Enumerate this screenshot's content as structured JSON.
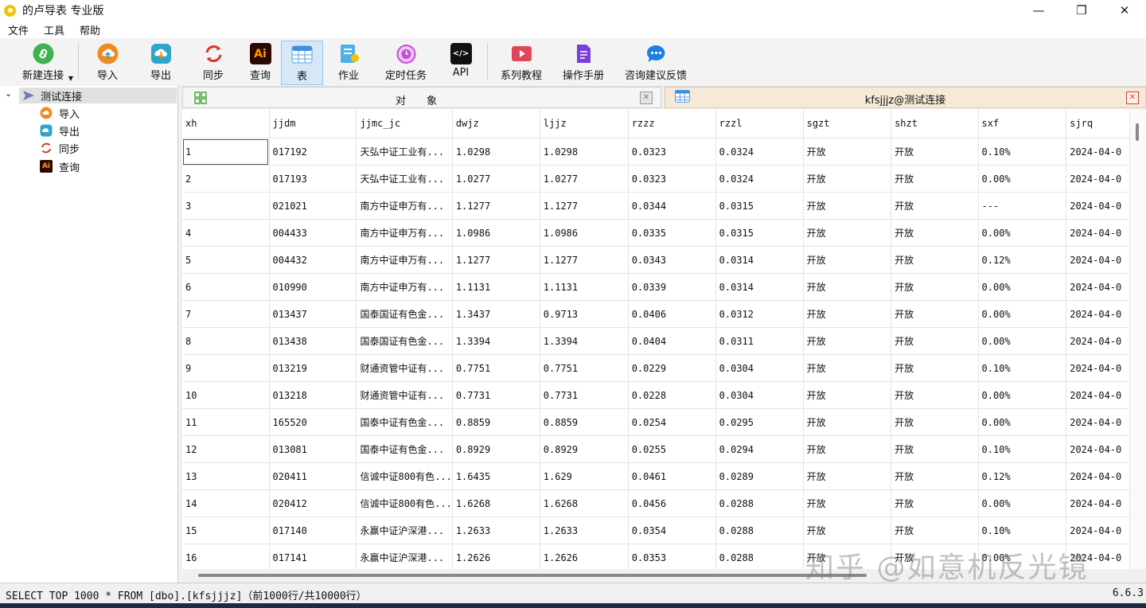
{
  "window": {
    "title": "的卢导表 专业版",
    "minimize": "—",
    "maximize": "❐",
    "close": "✕"
  },
  "menu": [
    "文件",
    "工具",
    "帮助"
  ],
  "toolbar": {
    "new_connection": "新建连接",
    "import": "导入",
    "export": "导出",
    "sync": "同步",
    "query": "查询",
    "table": "表",
    "job": "作业",
    "scheduled_task": "定时任务",
    "api": "API",
    "tutorials": "系列教程",
    "manual": "操作手册",
    "feedback": "咨询建议反馈",
    "query_icon_text": "Ai",
    "api_icon_text": "</>"
  },
  "tree": {
    "root": "测试连接",
    "items": [
      "导入",
      "导出",
      "同步",
      "查询"
    ],
    "query_icon_text": "Ai"
  },
  "tabs": {
    "objects_label": "对　　象",
    "objects_close": "✕",
    "table_tab_label": "kfsjjjz@测试连接",
    "table_tab_close": "✕"
  },
  "grid": {
    "columns": [
      "xh",
      "jjdm",
      "jjmc_jc",
      "dwjz",
      "ljjz",
      "rzzz",
      "rzzl",
      "sgzt",
      "shzt",
      "sxf",
      "sjrq"
    ],
    "rows": [
      [
        "1",
        "017192",
        "天弘中证工业有...",
        "1.0298",
        "1.0298",
        "0.0323",
        "0.0324",
        "开放",
        "开放",
        "0.10%",
        "2024-04-0"
      ],
      [
        "2",
        "017193",
        "天弘中证工业有...",
        "1.0277",
        "1.0277",
        "0.0323",
        "0.0324",
        "开放",
        "开放",
        "0.00%",
        "2024-04-0"
      ],
      [
        "3",
        "021021",
        "南方中证申万有...",
        "1.1277",
        "1.1277",
        "0.0344",
        "0.0315",
        "开放",
        "开放",
        "---",
        "2024-04-0"
      ],
      [
        "4",
        "004433",
        "南方中证申万有...",
        "1.0986",
        "1.0986",
        "0.0335",
        "0.0315",
        "开放",
        "开放",
        "0.00%",
        "2024-04-0"
      ],
      [
        "5",
        "004432",
        "南方中证申万有...",
        "1.1277",
        "1.1277",
        "0.0343",
        "0.0314",
        "开放",
        "开放",
        "0.12%",
        "2024-04-0"
      ],
      [
        "6",
        "010990",
        "南方中证申万有...",
        "1.1131",
        "1.1131",
        "0.0339",
        "0.0314",
        "开放",
        "开放",
        "0.00%",
        "2024-04-0"
      ],
      [
        "7",
        "013437",
        "国泰国证有色金...",
        "1.3437",
        "0.9713",
        "0.0406",
        "0.0312",
        "开放",
        "开放",
        "0.00%",
        "2024-04-0"
      ],
      [
        "8",
        "013438",
        "国泰国证有色金...",
        "1.3394",
        "1.3394",
        "0.0404",
        "0.0311",
        "开放",
        "开放",
        "0.00%",
        "2024-04-0"
      ],
      [
        "9",
        "013219",
        "财通资管中证有...",
        "0.7751",
        "0.7751",
        "0.0229",
        "0.0304",
        "开放",
        "开放",
        "0.10%",
        "2024-04-0"
      ],
      [
        "10",
        "013218",
        "财通资管中证有...",
        "0.7731",
        "0.7731",
        "0.0228",
        "0.0304",
        "开放",
        "开放",
        "0.00%",
        "2024-04-0"
      ],
      [
        "11",
        "165520",
        "国泰中证有色金...",
        "0.8859",
        "0.8859",
        "0.0254",
        "0.0295",
        "开放",
        "开放",
        "0.00%",
        "2024-04-0"
      ],
      [
        "12",
        "013081",
        "国泰中证有色金...",
        "0.8929",
        "0.8929",
        "0.0255",
        "0.0294",
        "开放",
        "开放",
        "0.10%",
        "2024-04-0"
      ],
      [
        "13",
        "020411",
        "信诚中证800有色...",
        "1.6435",
        "1.629",
        "0.0461",
        "0.0289",
        "开放",
        "开放",
        "0.12%",
        "2024-04-0"
      ],
      [
        "14",
        "020412",
        "信诚中证800有色...",
        "1.6268",
        "1.6268",
        "0.0456",
        "0.0288",
        "开放",
        "开放",
        "0.00%",
        "2024-04-0"
      ],
      [
        "15",
        "017140",
        "永赢中证沪深港...",
        "1.2633",
        "1.2633",
        "0.0354",
        "0.0288",
        "开放",
        "开放",
        "0.10%",
        "2024-04-0"
      ],
      [
        "16",
        "017141",
        "永赢中证沪深港...",
        "1.2626",
        "1.2626",
        "0.0353",
        "0.0288",
        "开放",
        "开放",
        "0.00%",
        "2024-04-0"
      ]
    ]
  },
  "status": {
    "sql": "SELECT TOP 1000 * FROM [dbo].[kfsjjjz]（前1000行/共10000行）",
    "version": "6.6.3"
  },
  "watermark": "知乎 @如意机反光镜",
  "colors": {
    "accent": "#d6e8f8",
    "tab_active": "#f7e9d7",
    "close_red": "#e0443a",
    "new_green": "#3fb24f",
    "import_orange": "#f08a22",
    "export_teal": "#2fa6c8",
    "sync_red": "#d9372b",
    "ai_dark": "#2a0a00",
    "ai_orange": "#ff9a00",
    "feedback_blue": "#1e7fe0",
    "manual_purple": "#7b3fd8"
  },
  "icons": {
    "new": "link-icon",
    "import": "cloud-upload-icon",
    "export": "cloud-download-icon",
    "sync": "sync-icon",
    "query": "ai-icon",
    "table": "table-icon",
    "job": "job-icon",
    "scheduled": "clock-icon",
    "api": "code-icon",
    "tutorials": "video-icon",
    "manual": "document-icon",
    "feedback": "chat-icon"
  }
}
